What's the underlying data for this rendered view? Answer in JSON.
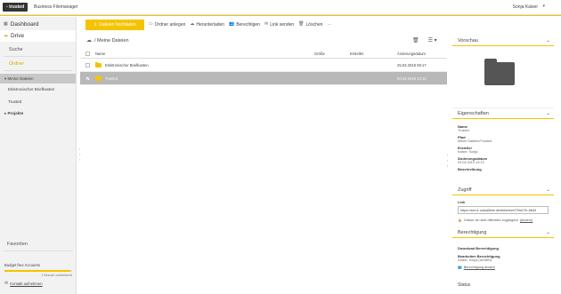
{
  "header": {
    "logo": "trusted",
    "app_title": "Business Filemanager",
    "user_name": "Sonja Kaiser",
    "accent_color": "#f5c400"
  },
  "sidebar": {
    "dashboard": "Dashboard",
    "drive": "Drive",
    "search": "Suche",
    "folders": "Ordner",
    "tree": [
      {
        "label": "Meine Dateien",
        "level": 0,
        "selected": true,
        "expanded": true
      },
      {
        "label": "Elektronischer Briefkasten",
        "level": 1,
        "selected": false
      },
      {
        "label": "Trusted",
        "level": 1,
        "selected": false
      },
      {
        "label": "Projekte",
        "level": 0,
        "selected": false,
        "expanded": false
      }
    ],
    "favorites": "Favoriten",
    "quota_label": "Budget free Accounts",
    "quota_text": "1 Besuch verbleibend",
    "quota_fraction": 0.98,
    "contact": "Kontakt aufnehmen"
  },
  "toolbar": {
    "upload": "Dateien hochladen",
    "new_folder": "Ordner anlegen",
    "download": "Herunterladen",
    "permissions": "Berechtigen",
    "send_link": "Link senden",
    "delete": "Löschen",
    "more": "⋯"
  },
  "breadcrumb": "/ Meine Dateien",
  "table": {
    "columns": {
      "name": "Name",
      "size": "Größe",
      "owner": "Ersteller",
      "date": "Änderungsdatum"
    },
    "rows": [
      {
        "name": "Elektronischer Briefkasten",
        "size": "",
        "owner": "",
        "date": "25.03.2019 08:17",
        "selected": false
      },
      {
        "name": "Trusted",
        "size": "",
        "owner": "",
        "date": "03.04.2019 13:13",
        "selected": true
      }
    ]
  },
  "right_panel": {
    "preview_title": "Vorschau",
    "properties_title": "Eigenschaften",
    "props": [
      {
        "label": "Name",
        "value": "Trusted"
      },
      {
        "label": "Pfad",
        "value": "Meine Dateien/Trusted"
      },
      {
        "label": "Ersteller",
        "value": "Kaiser, Sonja"
      },
      {
        "label": "Änderungsdatum",
        "value": "03.04.2019 13:13"
      },
      {
        "label": "Beschreibung",
        "value": ""
      }
    ],
    "access_title": "Zugriff",
    "link_label": "Link",
    "link_value": "https://sem1.carsaltime.de/teildrieve/7f4d17b-8bd3",
    "lock_text": "Ordner ist nicht öffentlich zugänglich",
    "lock_link": "(ändern)",
    "permission_title": "Berechtigung",
    "download_perm_label": "Download Berechtigung",
    "download_perm_value": "",
    "edit_perm_label": "Bearbeiten Berechtigung",
    "edit_perm_value": "Kaiser, Sonja (ADMIN)",
    "perm_link": "Berechtigung ändern",
    "status_title": "Status"
  }
}
